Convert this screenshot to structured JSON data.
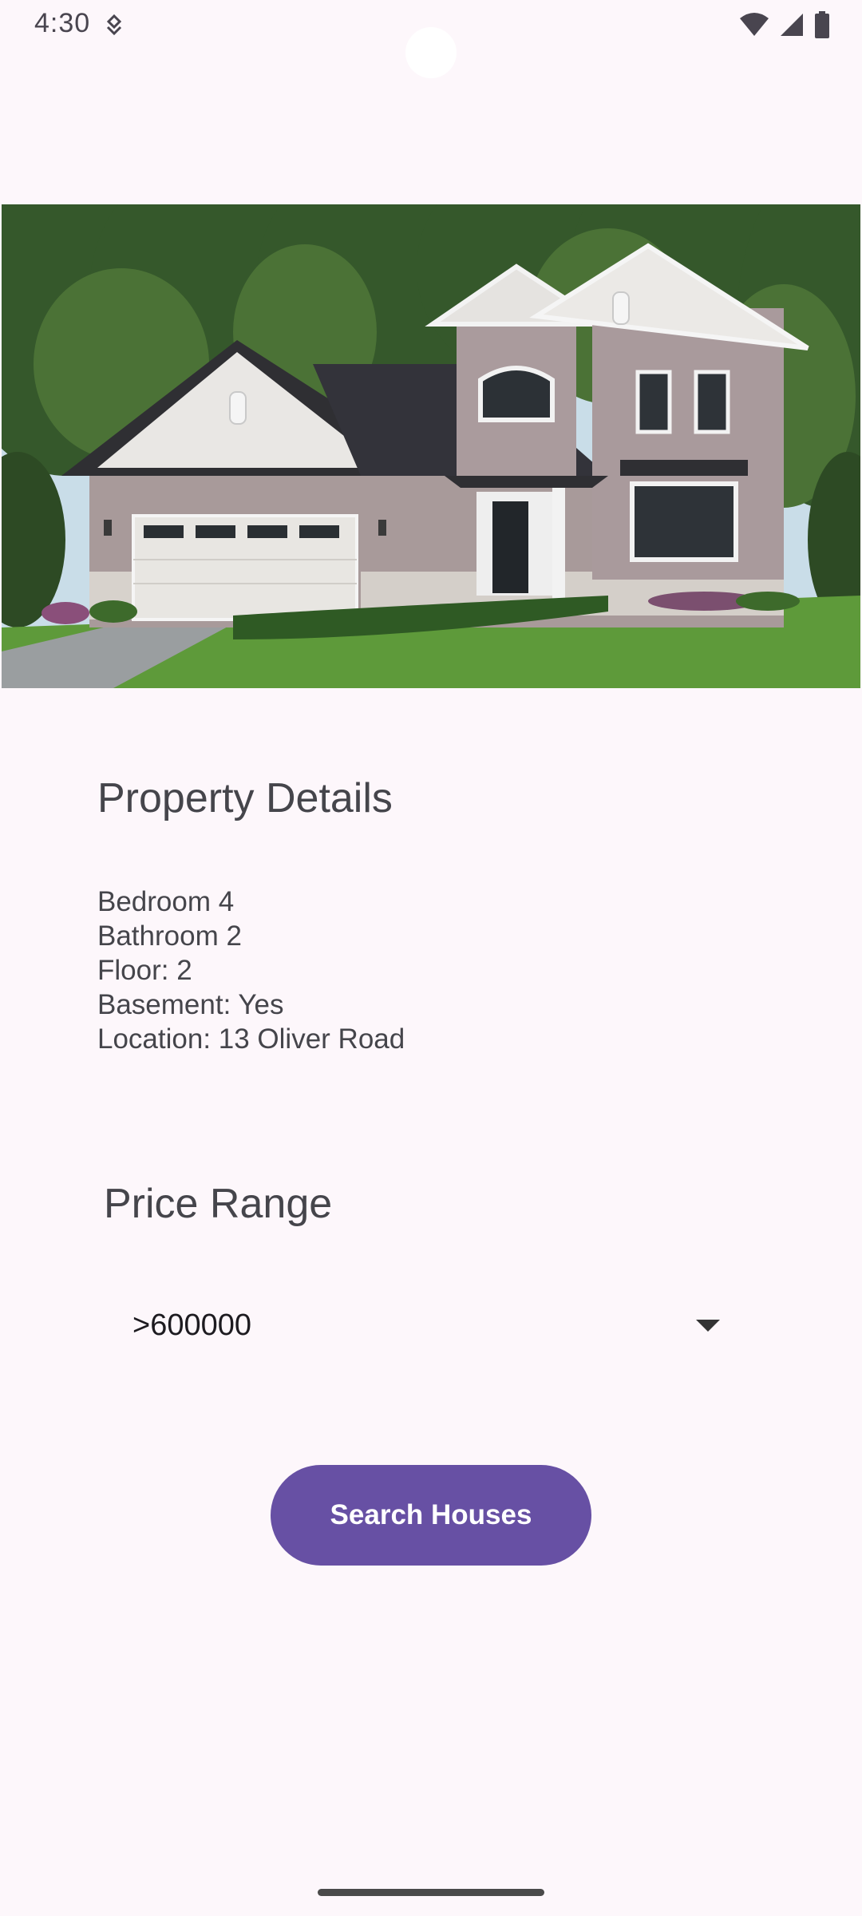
{
  "status_bar": {
    "time": "4:30"
  },
  "property": {
    "title": "Property Details",
    "bedroom": "Bedroom 4",
    "bathroom": "Bathroom 2",
    "floor": "Floor: 2",
    "basement": "Basement: Yes",
    "location": "Location: 13 Oliver Road"
  },
  "price": {
    "title": "Price Range",
    "selected": ">600000"
  },
  "actions": {
    "search_label": "Search Houses"
  },
  "colors": {
    "background": "#fdf7fb",
    "primary": "#6750a4"
  },
  "icons": [
    "notification-icon",
    "wifi-icon",
    "signal-icon",
    "battery-icon",
    "dropdown-arrow-icon"
  ]
}
